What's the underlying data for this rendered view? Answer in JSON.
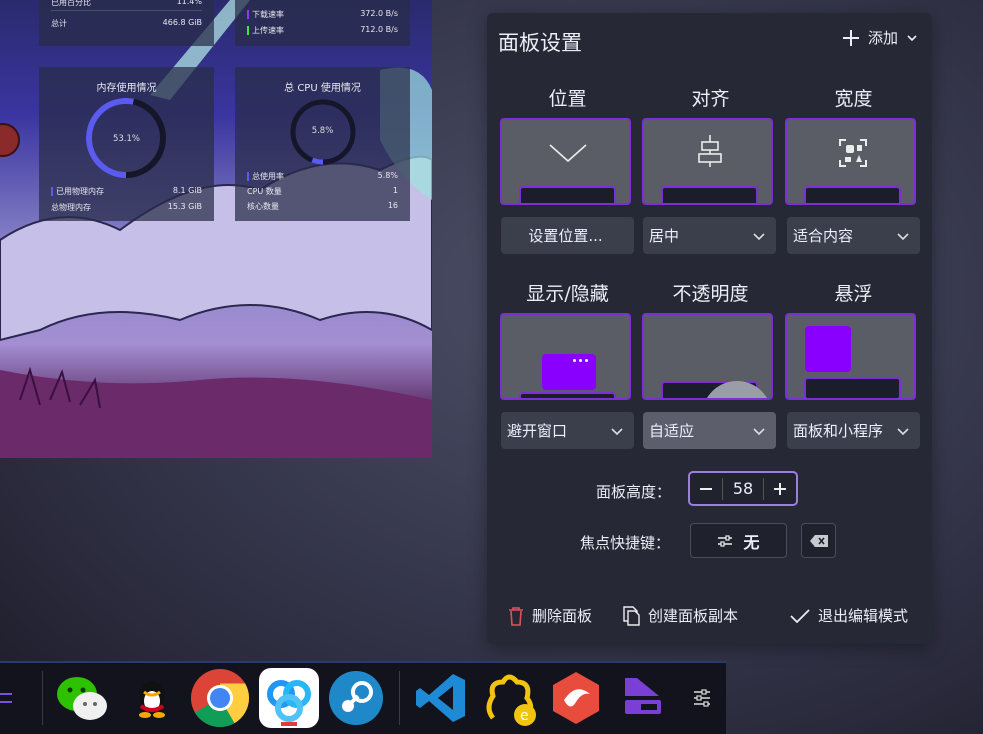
{
  "monitor": {
    "disk": {
      "used_pct_label": "已用百分比",
      "used_pct_value": "11.4%",
      "total_label": "总计",
      "total_value": "466.8 GiB"
    },
    "network": {
      "download_label": "下载速率",
      "download_value": "372.0 B/s",
      "upload_label": "上传速率",
      "upload_value": "712.0 B/s"
    },
    "memory": {
      "title": "内存使用情况",
      "percent": "53.1%",
      "fraction": 0.531,
      "used_label": "已用物理内存",
      "used_value": "8.1 GiB",
      "total_label": "总物理内存",
      "total_value": "15.3 GiB"
    },
    "cpu": {
      "title": "总 CPU 使用情况",
      "percent": "5.8%",
      "fraction": 0.058,
      "usage_label": "总使用率",
      "usage_value": "5.8%",
      "count_label": "CPU 数量",
      "count_value": "1",
      "cores_label": "核心数量",
      "cores_value": "16"
    }
  },
  "panel": {
    "title": "面板设置",
    "add_label": "添加",
    "columns": {
      "position": "位置",
      "alignment": "对齐",
      "width": "宽度",
      "visibility": "显示/隐藏",
      "opacity": "不透明度",
      "floating": "悬浮"
    },
    "controls": {
      "set_position": "设置位置...",
      "alignment_value": "居中",
      "width_value": "适合内容",
      "visibility_value": "避开窗口",
      "opacity_value": "自适应",
      "floating_value": "面板和小程序"
    },
    "height_label": "面板高度：",
    "height_value": "58",
    "shortcut_label": "焦点快捷键：",
    "shortcut_value": "无",
    "delete_label": "删除面板",
    "clone_label": "创建面板副本",
    "exit_label": "退出编辑模式"
  },
  "colors": {
    "accent": "#7b2fd4",
    "panel_bg": "#262836",
    "memory_ring": "#5b5bf0",
    "cpu_ring": "#5b5bf0"
  },
  "taskbar": {
    "icons": [
      "wechat-icon",
      "qq-icon",
      "chrome-icon",
      "baidu-netdisk-icon",
      "steam-icon",
      "vscode-icon",
      "eclipse-icon",
      "app-red-icon",
      "panel-app-icon",
      "settings-icon"
    ]
  }
}
